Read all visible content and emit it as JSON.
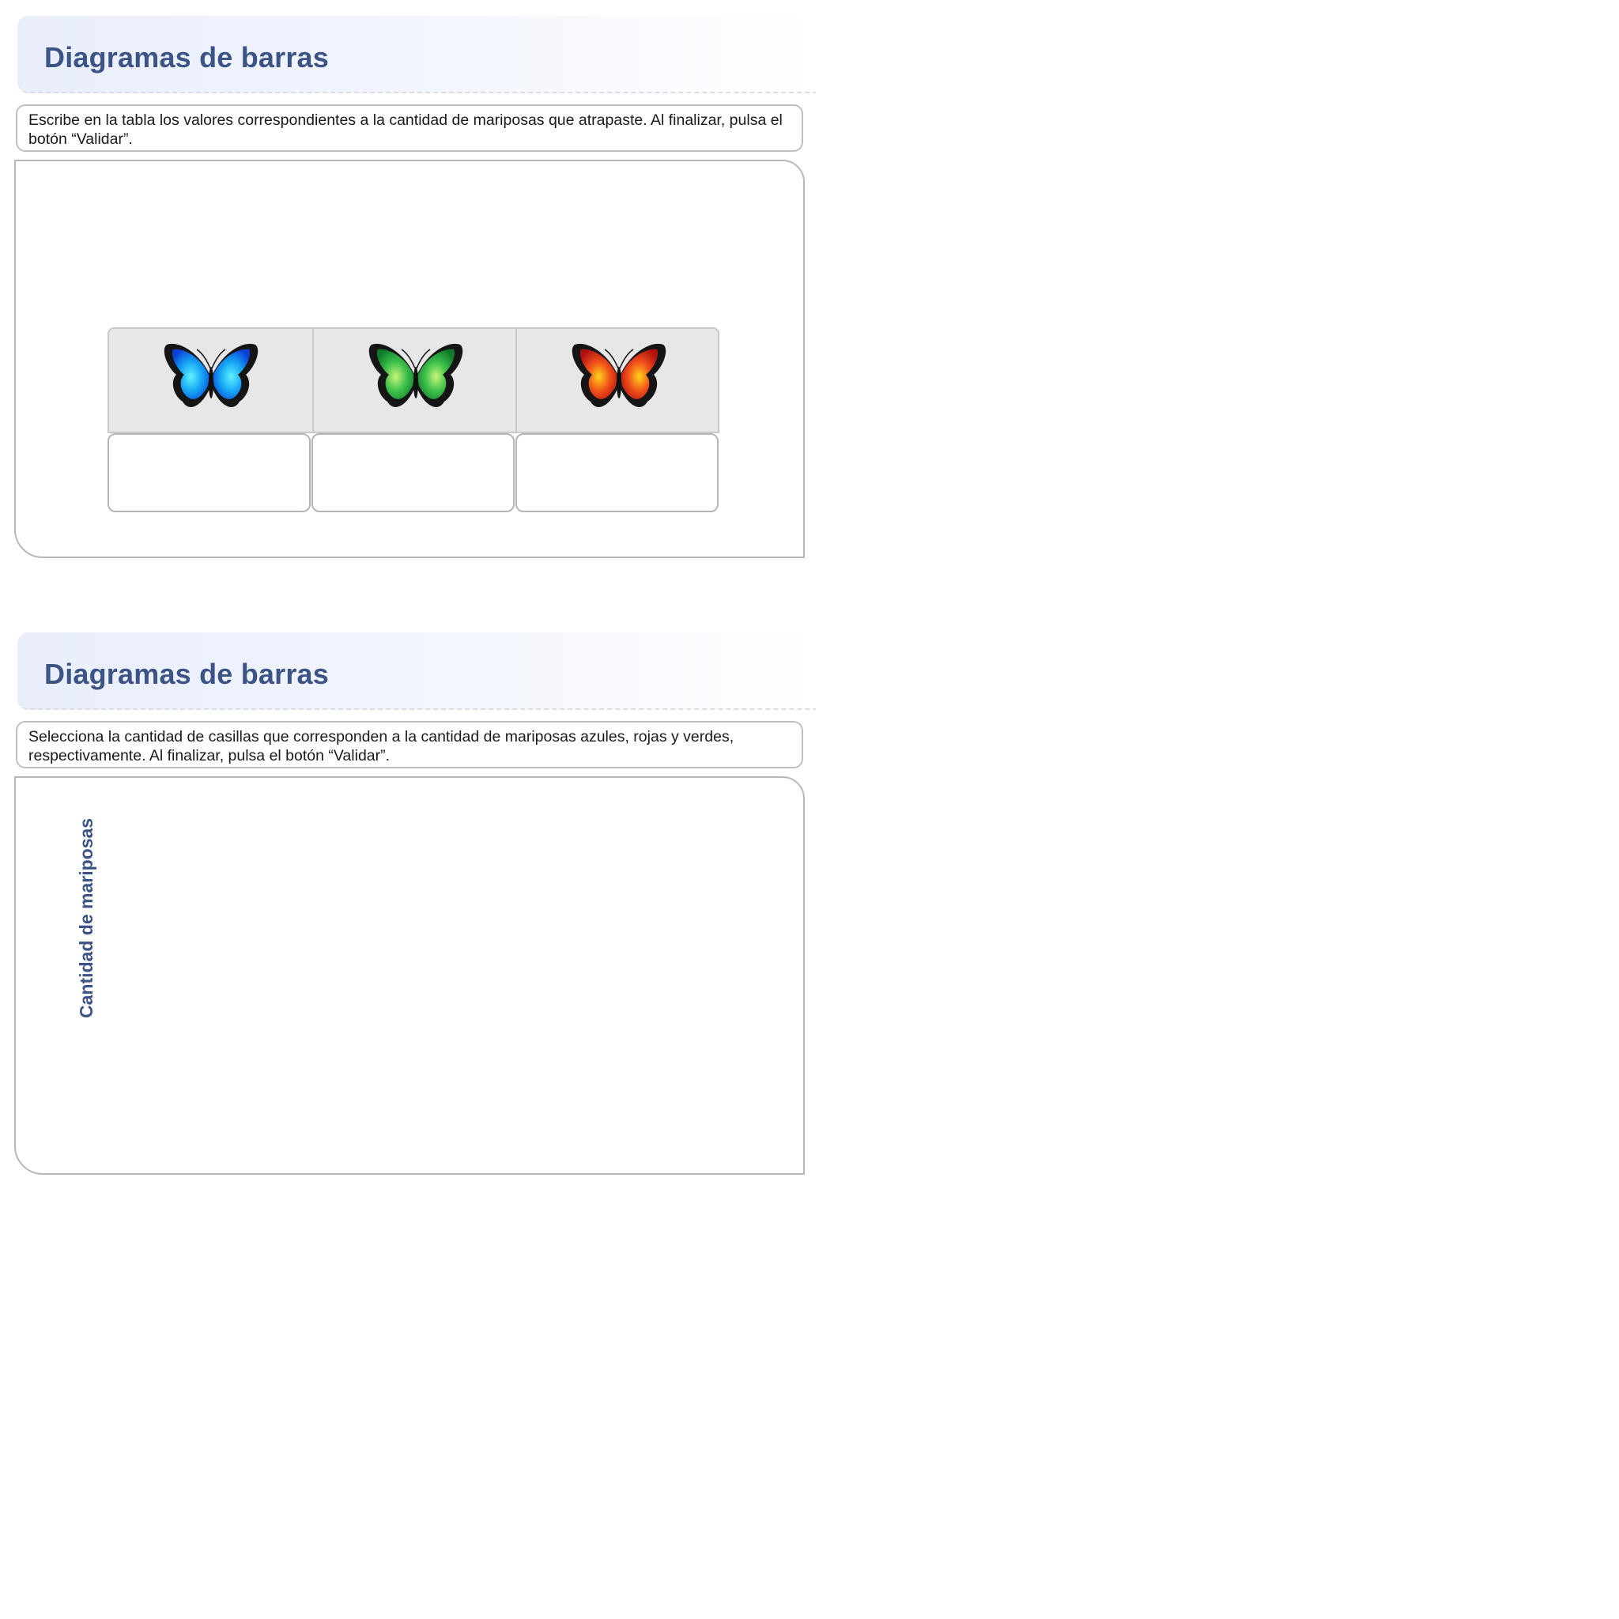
{
  "activity_1": {
    "title": "Diagramas de barras",
    "instructions": "Escribe en la tabla  los valores correspondientes a la cantidad de mariposas que atrapaste. Al finalizar, pulsa el botón “Validar”.",
    "table": {
      "columns": [
        {
          "icon": "blue-butterfly-icon",
          "color": "#1e90ff",
          "value": ""
        },
        {
          "icon": "green-butterfly-icon",
          "color": "#2fb34a",
          "value": ""
        },
        {
          "icon": "red-butterfly-icon",
          "color": "#e2261c",
          "value": ""
        }
      ]
    }
  },
  "activity_2": {
    "title": "Diagramas de barras",
    "instructions": "Selecciona la cantidad de casillas que corresponden a la cantidad de mariposas azules, rojas y verdes, respectivamente. Al finalizar, pulsa el botón “Validar”.",
    "y_axis_label": "Cantidad de mariposas"
  },
  "colors": {
    "title": "#3c5386",
    "border": "#b8b8b8",
    "table_header_bg": "#e6e7e6"
  }
}
